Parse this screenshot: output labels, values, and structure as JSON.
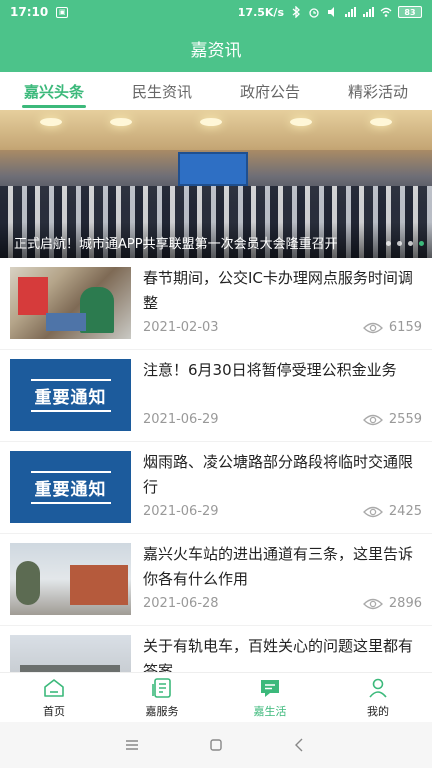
{
  "status_bar": {
    "time": "17:10",
    "speed": "17.5K/s",
    "battery": "83"
  },
  "header": {
    "title": "嘉资讯"
  },
  "tabs": [
    {
      "label": "嘉兴头条",
      "active": true
    },
    {
      "label": "民生资讯",
      "active": false
    },
    {
      "label": "政府公告",
      "active": false
    },
    {
      "label": "精彩活动",
      "active": false
    }
  ],
  "banner": {
    "caption": "正式启航！城市通APP共享联盟第一次会员大会隆重召开"
  },
  "news": [
    {
      "title": "春节期间，公交IC卡办理网点服务时间调整",
      "date": "2021-02-03",
      "views": "6159",
      "thumb": "photo"
    },
    {
      "title": "注意！6月30日将暂停受理公积金业务",
      "date": "2021-06-29",
      "views": "2559",
      "thumb_text": "重要通知"
    },
    {
      "title": "烟雨路、凌公塘路部分路段将临时交通限行",
      "date": "2021-06-29",
      "views": "2425",
      "thumb_text": "重要通知"
    },
    {
      "title": "嘉兴火车站的进出通道有三条，这里告诉你各有什么作用",
      "date": "2021-06-28",
      "views": "2896",
      "thumb": "photo"
    },
    {
      "title": "关于有轨电车，百姓关心的问题这里都有答案",
      "date": "",
      "views": "",
      "thumb": "photo"
    }
  ],
  "bottom_nav": [
    {
      "label": "首页",
      "icon": "home-icon",
      "active": false
    },
    {
      "label": "嘉服务",
      "icon": "service-icon",
      "active": false
    },
    {
      "label": "嘉生活",
      "icon": "chat-icon",
      "active": true
    },
    {
      "label": "我的",
      "icon": "user-icon",
      "active": false
    }
  ],
  "colors": {
    "brand": "#4cc38a",
    "accent": "#3cb97b",
    "notice_blue": "#1c5b9c"
  }
}
